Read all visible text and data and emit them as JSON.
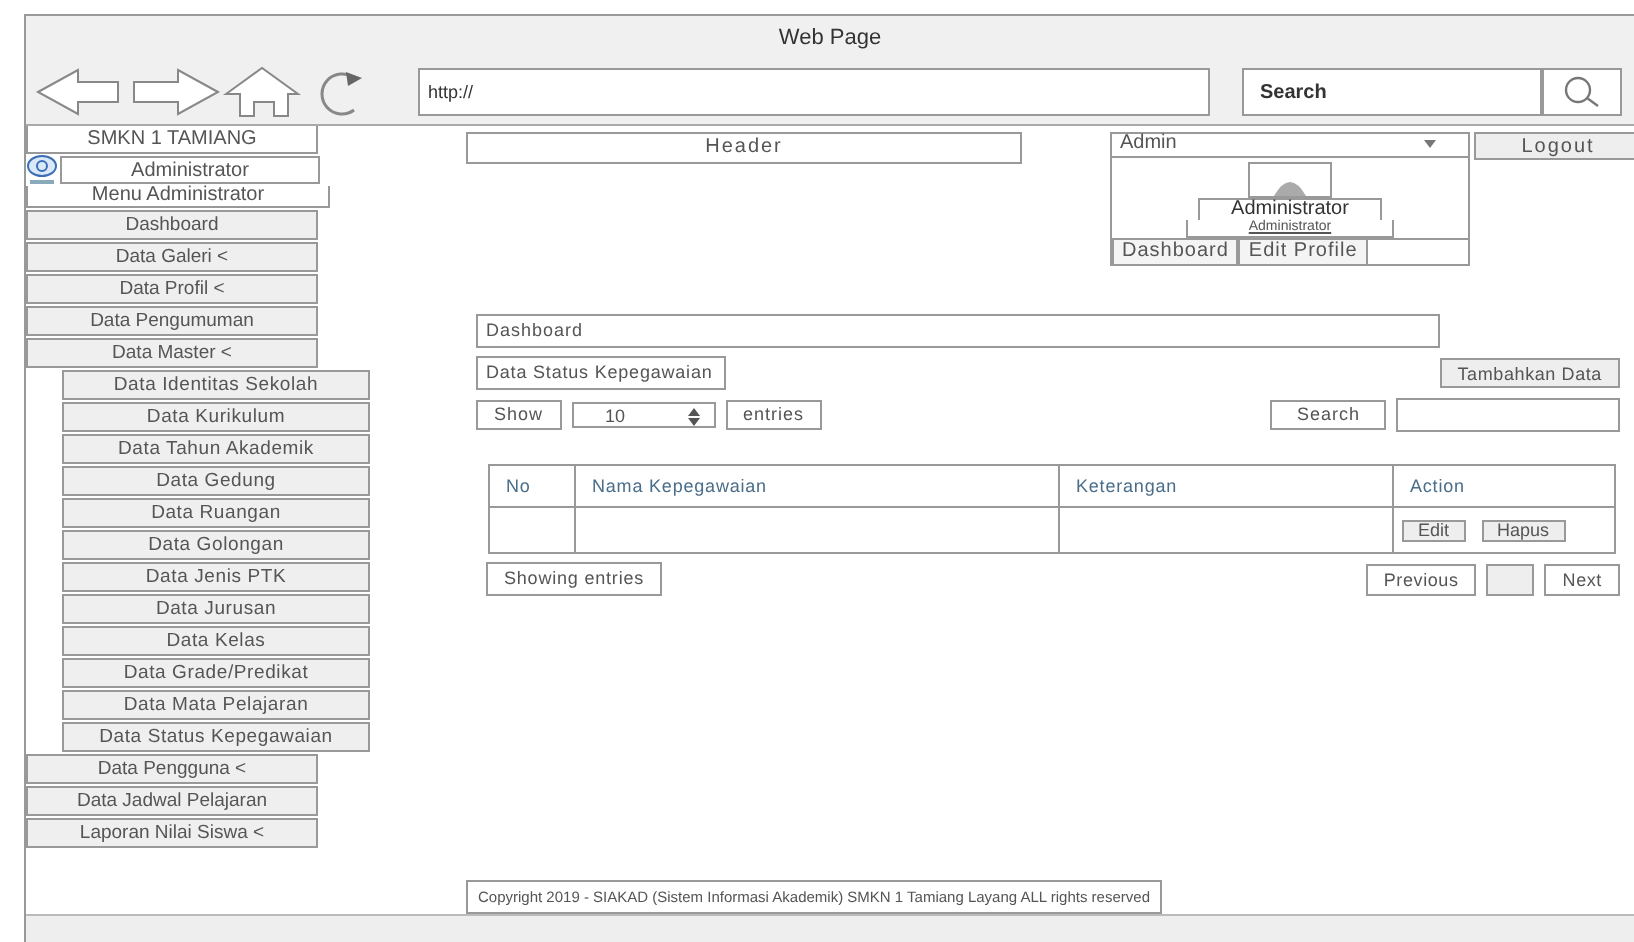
{
  "window": {
    "title": "Web Page"
  },
  "browser": {
    "url": "http://",
    "search_placeholder": "Search"
  },
  "sidebar": {
    "school": "SMKN 1 TAMIANG",
    "role": "Administrator",
    "menu_title": "Menu Administrator",
    "items": [
      {
        "label": "Dashboard"
      },
      {
        "label": "Data Galeri <"
      },
      {
        "label": "Data Profil <"
      },
      {
        "label": "Data Pengumuman"
      },
      {
        "label": "Data Master <",
        "children": [
          {
            "label": "Data Identitas Sekolah"
          },
          {
            "label": "Data Kurikulum"
          },
          {
            "label": "Data Tahun Akademik"
          },
          {
            "label": "Data Gedung"
          },
          {
            "label": "Data Ruangan"
          },
          {
            "label": "Data Golongan"
          },
          {
            "label": "Data Jenis PTK"
          },
          {
            "label": "Data Jurusan"
          },
          {
            "label": "Data Kelas"
          },
          {
            "label": "Data Grade/Predikat"
          },
          {
            "label": "Data Mata Pelajaran"
          },
          {
            "label": "Data Status Kepegawaian"
          }
        ]
      },
      {
        "label": "Data Pengguna <"
      },
      {
        "label": "Data Jadwal Pelajaran"
      },
      {
        "label": "Laporan Nilai Siswa <"
      }
    ]
  },
  "header": {
    "label": "Header"
  },
  "user_panel": {
    "dropdown": "Admin",
    "name": "Administrator",
    "role": "Administrator",
    "buttons": [
      "Dashboard",
      "Edit Profile"
    ]
  },
  "logout": "Logout",
  "content": {
    "breadcrumb": "Dashboard",
    "title": "Data Status Kepegawaian",
    "add_button": "Tambahkan Data",
    "show_label": "Show",
    "page_size": "10",
    "entries_label": "entries",
    "search_label": "Search",
    "table": {
      "columns": [
        "No",
        "Nama Kepegawaian",
        "Keterangan",
        "Action"
      ],
      "rows": [
        {
          "actions": [
            "Edit",
            "Hapus"
          ]
        }
      ]
    },
    "info": "Showing entries",
    "pagination": {
      "previous": "Previous",
      "next": "Next"
    }
  },
  "footer": "Copyright 2019 - SIAKAD (Sistem Informasi Akademik) SMKN 1 Tamiang Layang ALL rights reserved"
}
